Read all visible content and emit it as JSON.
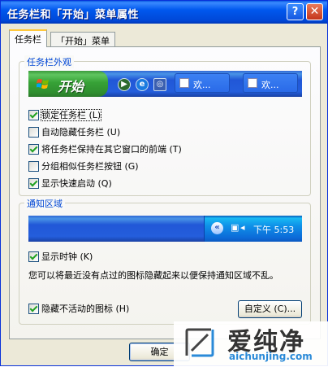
{
  "window": {
    "title": "任务栏和「开始」菜单属性",
    "help_label": "?",
    "close_label": "✕"
  },
  "tabs": [
    {
      "label": "任务栏",
      "active": true
    },
    {
      "label": "「开始」菜单",
      "active": false
    }
  ],
  "appearance": {
    "group_title": "任务栏外观",
    "taskbar": {
      "start_label": "开始",
      "task_buttons": [
        "欢...",
        "欢..."
      ],
      "quick_launch_icons": [
        "media-player-icon",
        "ie-icon",
        "outlook-icon"
      ]
    },
    "options": [
      {
        "label": "锁定任务栏 (L)",
        "checked": true
      },
      {
        "label": "自动隐藏任务栏 (U)",
        "checked": false
      },
      {
        "label": "将任务栏保持在其它窗口的前端 (T)",
        "checked": true
      },
      {
        "label": "分组相似任务栏按钮 (G)",
        "checked": false
      },
      {
        "label": "显示快速启动 (Q)",
        "checked": true
      }
    ]
  },
  "notification": {
    "group_title": "通知区域",
    "tray": {
      "chevron": "«",
      "clock": "下午 5:53"
    },
    "show_clock": {
      "label": "显示时钟 (K)",
      "checked": true
    },
    "description": "您可以将最近没有点过的图标隐藏起来以便保持通知区域不乱。",
    "hide_inactive": {
      "label": "隐藏不活动的图标 (H)",
      "checked": true
    },
    "customize_label": "自定义 (C)..."
  },
  "footer": {
    "ok_label": "确定"
  },
  "watermark": {
    "text_cn": "爱纯净",
    "text_en": "aichunjing.com"
  },
  "colors": {
    "title_bar": "#0058ee",
    "group_title": "#0046d5",
    "start_button": "#37a237",
    "tray": "#0f90e8"
  }
}
